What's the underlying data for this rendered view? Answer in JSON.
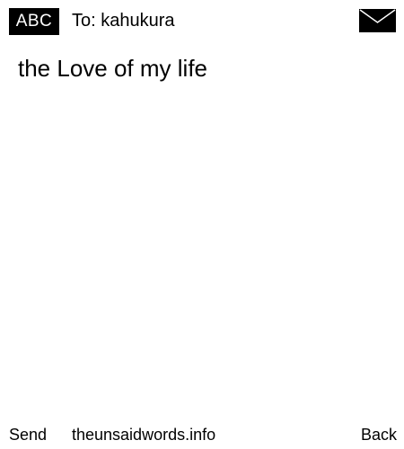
{
  "header": {
    "input_mode": "ABC",
    "recipient": "To: kahukura",
    "mail_icon": "envelope-icon"
  },
  "message": {
    "text": "the Love of my life"
  },
  "footer": {
    "send_label": "Send",
    "site_label": "theunsaidwords.info",
    "back_label": "Back"
  },
  "colors": {
    "background": "#ffffff",
    "foreground": "#000000",
    "badge_background": "#000000",
    "badge_text": "#ffffff"
  }
}
